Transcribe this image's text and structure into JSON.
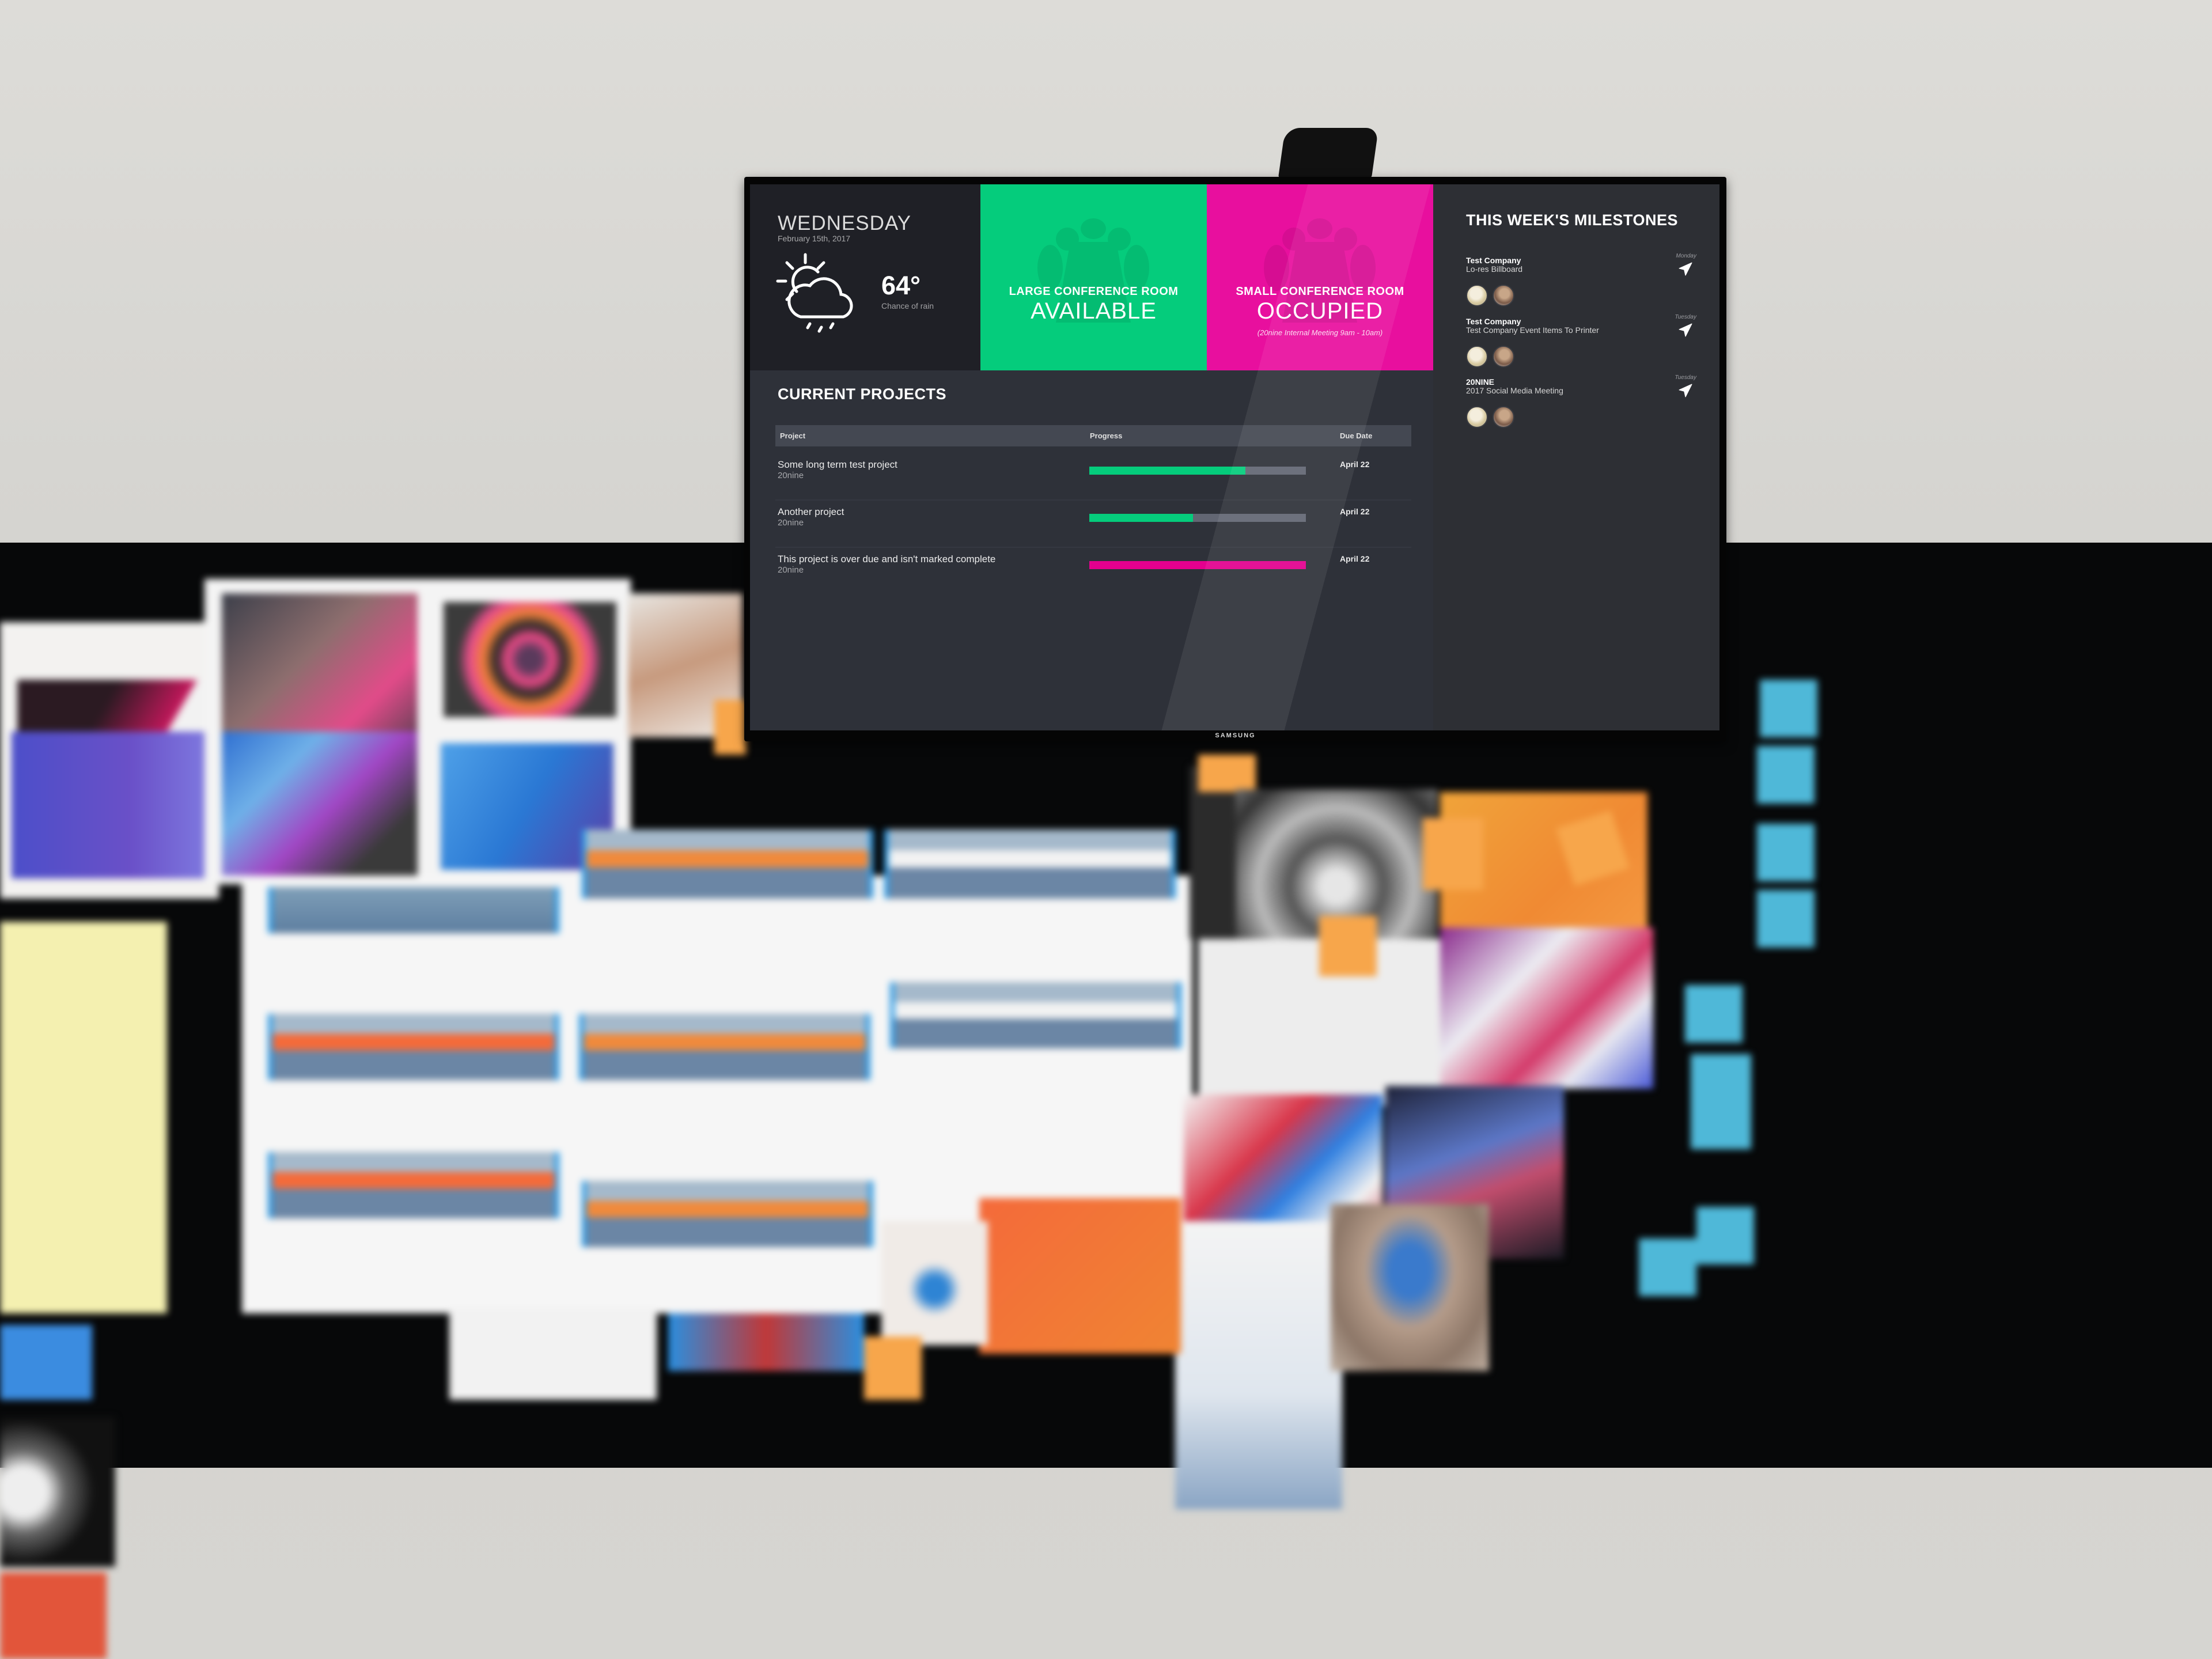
{
  "device": {
    "brand": "SAMSUNG"
  },
  "colors": {
    "available": "#05CC7C",
    "occupied": "#E80F9E",
    "progress_ok": "#05CC7C",
    "progress_overdue": "#E3008E",
    "progress_track": "#626673"
  },
  "weather": {
    "day": "WEDNESDAY",
    "date": "February 15th, 2017",
    "icon": "partly-cloudy-rain-icon",
    "temperature": "64°",
    "condition": "Chance of rain"
  },
  "rooms": [
    {
      "name": "LARGE CONFERENCE ROOM",
      "status": "AVAILABLE",
      "note": ""
    },
    {
      "name": "SMALL CONFERENCE ROOM",
      "status": "OCCUPIED",
      "note": "(20nine Internal Meeting 9am - 10am)"
    }
  ],
  "projects": {
    "title": "CURRENT PROJECTS",
    "columns": [
      "Project",
      "Progress",
      "Due Date"
    ],
    "rows": [
      {
        "name": "Some long term test project",
        "client": "20nine",
        "progress": 0.72,
        "status": "on-track",
        "due": "April 22"
      },
      {
        "name": "Another project",
        "client": "20nine",
        "progress": 0.48,
        "status": "on-track",
        "due": "April 22"
      },
      {
        "name": "This project is over due and isn't marked complete",
        "client": "20nine",
        "progress": 1.0,
        "status": "overdue",
        "due": "April 22"
      }
    ]
  },
  "milestones": {
    "title": "THIS WEEK'S MILESTONES",
    "items": [
      {
        "company": "Test Company",
        "task": "Lo-res Billboard",
        "day": "Monday",
        "icon": "send-icon",
        "assignees": 2
      },
      {
        "company": "Test Company",
        "task": "Test Company Event Items To Printer",
        "day": "Tuesday",
        "icon": "send-icon",
        "assignees": 2
      },
      {
        "company": "20NINE",
        "task": "2017 Social Media Meeting",
        "day": "Tuesday",
        "icon": "send-icon",
        "assignees": 2
      }
    ]
  }
}
